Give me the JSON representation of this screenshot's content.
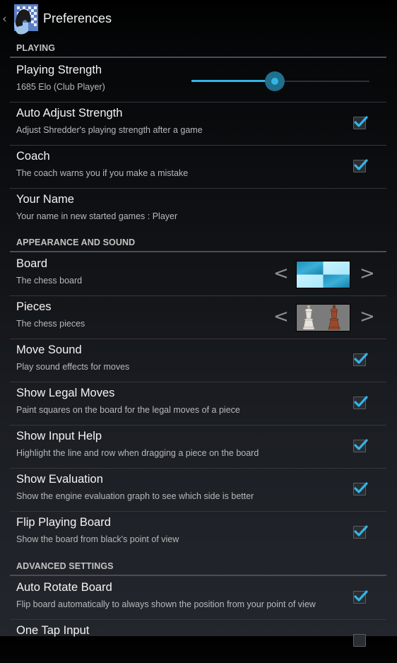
{
  "actionbar": {
    "up_icon": "chevron-left-icon",
    "app_icon": "shredder-chess-knight-icon",
    "title": "Preferences"
  },
  "sections": [
    {
      "label": "PLAYING",
      "items": [
        {
          "title": "Playing Strength",
          "summary": "1685 Elo (Club Player)",
          "widget": "slider",
          "slider_fraction": 0.47,
          "accent": "#33b5e5"
        },
        {
          "title": "Auto Adjust Strength",
          "summary": "Adjust Shredder's playing strength after a game",
          "widget": "checkbox",
          "checked": true
        },
        {
          "title": "Coach",
          "summary": "The coach warns you if you make a mistake",
          "widget": "checkbox",
          "checked": true
        },
        {
          "title": "Your Name",
          "summary": "Your name in new started games : Player",
          "widget": "none"
        }
      ]
    },
    {
      "label": "APPEARANCE AND SOUND",
      "items": [
        {
          "title": "Board",
          "summary": "The chess board",
          "widget": "selector",
          "prev_label": "<",
          "next_label": ">",
          "preview": "blue-marble-board"
        },
        {
          "title": "Pieces",
          "summary": "The chess pieces",
          "widget": "selector",
          "prev_label": "<",
          "next_label": ">",
          "preview": "wooden-king-pieces"
        },
        {
          "title": "Move Sound",
          "summary": "Play sound effects for moves",
          "widget": "checkbox",
          "checked": true
        },
        {
          "title": "Show Legal Moves",
          "summary": "Paint squares on the board for the legal moves of a piece",
          "widget": "checkbox",
          "checked": true
        },
        {
          "title": "Show Input Help",
          "summary": "Highlight the line and row when dragging a piece on the board",
          "widget": "checkbox",
          "checked": true
        },
        {
          "title": "Show Evaluation",
          "summary": "Show the engine evaluation graph to see which side is better",
          "widget": "checkbox",
          "checked": true
        },
        {
          "title": "Flip Playing Board",
          "summary": "Show the board from black's point of view",
          "widget": "checkbox",
          "checked": true
        }
      ]
    },
    {
      "label": "ADVANCED SETTINGS",
      "items": [
        {
          "title": "Auto Rotate Board",
          "summary": "Flip board automatically to always shown the position from your point of view",
          "widget": "checkbox",
          "checked": true
        },
        {
          "title": "One Tap Input",
          "summary": "",
          "widget": "checkbox",
          "checked": false
        }
      ]
    }
  ],
  "colors": {
    "accent": "#33b5e5",
    "section_label": "#c2c2c2",
    "summary_text": "#b7b9bc"
  }
}
